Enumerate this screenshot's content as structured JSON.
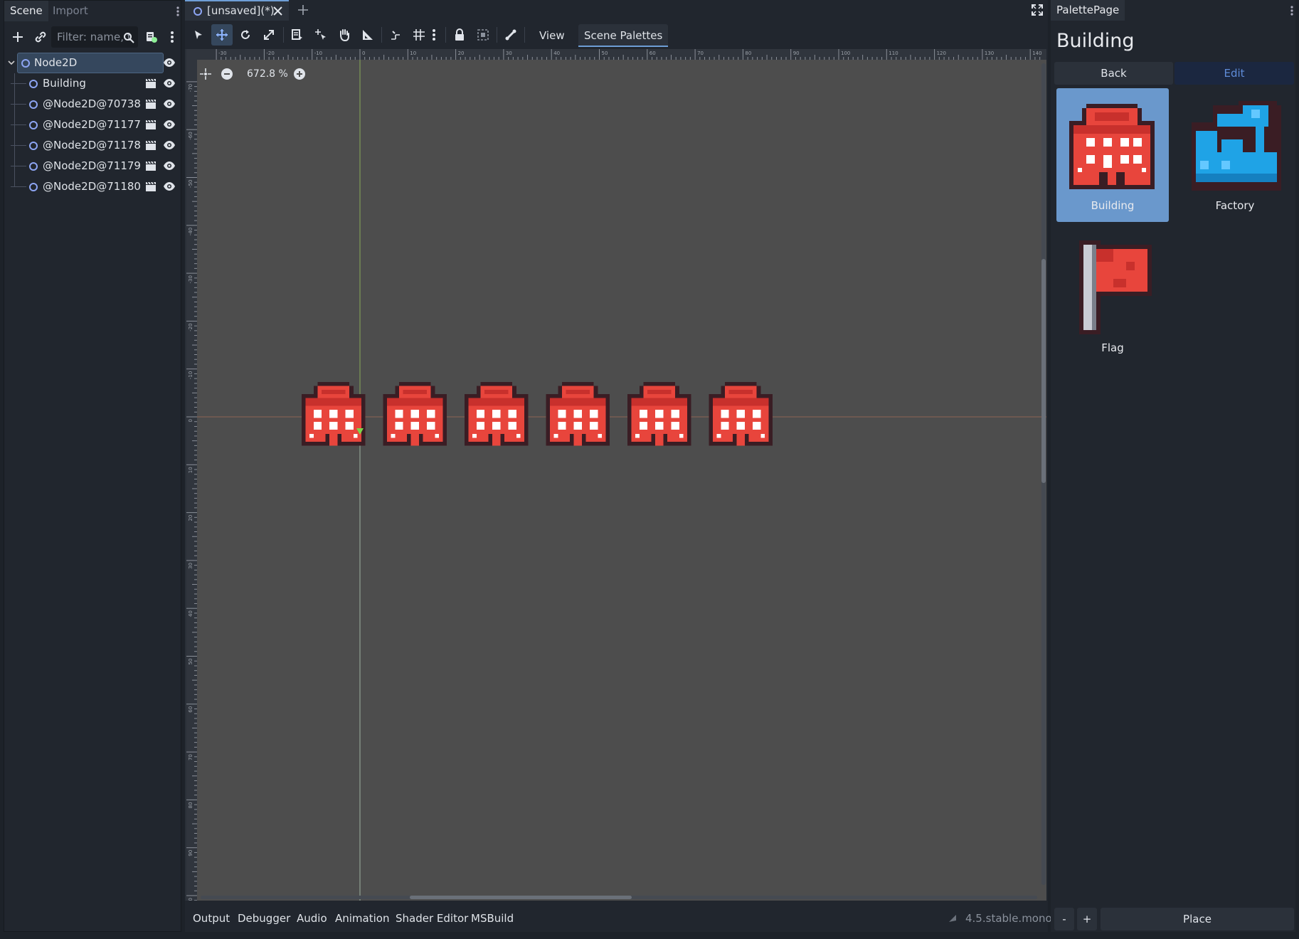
{
  "scene_dock": {
    "tabs": [
      "Scene",
      "Import"
    ],
    "filter_placeholder": "Filter: name, t",
    "tree": [
      {
        "label": "Node2D",
        "selected": true
      },
      {
        "label": "Building"
      },
      {
        "label": "@Node2D@70738"
      },
      {
        "label": "@Node2D@71177"
      },
      {
        "label": "@Node2D@71178"
      },
      {
        "label": "@Node2D@71179"
      },
      {
        "label": "@Node2D@71180"
      }
    ]
  },
  "editor": {
    "scene_tab": "[unsaved](*)",
    "toolbar": {
      "view_label": "View",
      "scene_palettes_label": "Scene Palettes"
    },
    "zoom_label": "672.8 %",
    "ruler_top_labels": [
      "-30",
      "-20",
      "-10",
      "0",
      "10",
      "20",
      "30",
      "40",
      "50",
      "60",
      "70",
      "80",
      "90",
      "100",
      "110",
      "120",
      "130",
      "140"
    ],
    "ruler_left_labels": [
      "-70",
      "-60",
      "-50",
      "-40",
      "-30",
      "-20",
      "-10",
      "0",
      "10",
      "20",
      "30",
      "40",
      "50",
      "60",
      "70",
      "80",
      "90",
      "100"
    ],
    "bottom_tabs": [
      "Output",
      "Debugger",
      "Audio",
      "Animation",
      "Shader Editor",
      "MSBuild"
    ],
    "version": "4.5.stable.mono",
    "building_count": 6
  },
  "palette_dock": {
    "tab": "PalettePage",
    "title": "Building",
    "back_label": "Back",
    "edit_label": "Edit",
    "items": [
      {
        "label": "Building",
        "selected": true
      },
      {
        "label": "Factory"
      },
      {
        "label": "Flag"
      }
    ],
    "minus_label": "-",
    "plus_label": "+",
    "place_label": "Place"
  },
  "colors": {
    "accent": "#6e9ed6",
    "node_icon": "#8da5f3",
    "building_red": "#e8453c",
    "factory_blue": "#1fa3e6"
  }
}
